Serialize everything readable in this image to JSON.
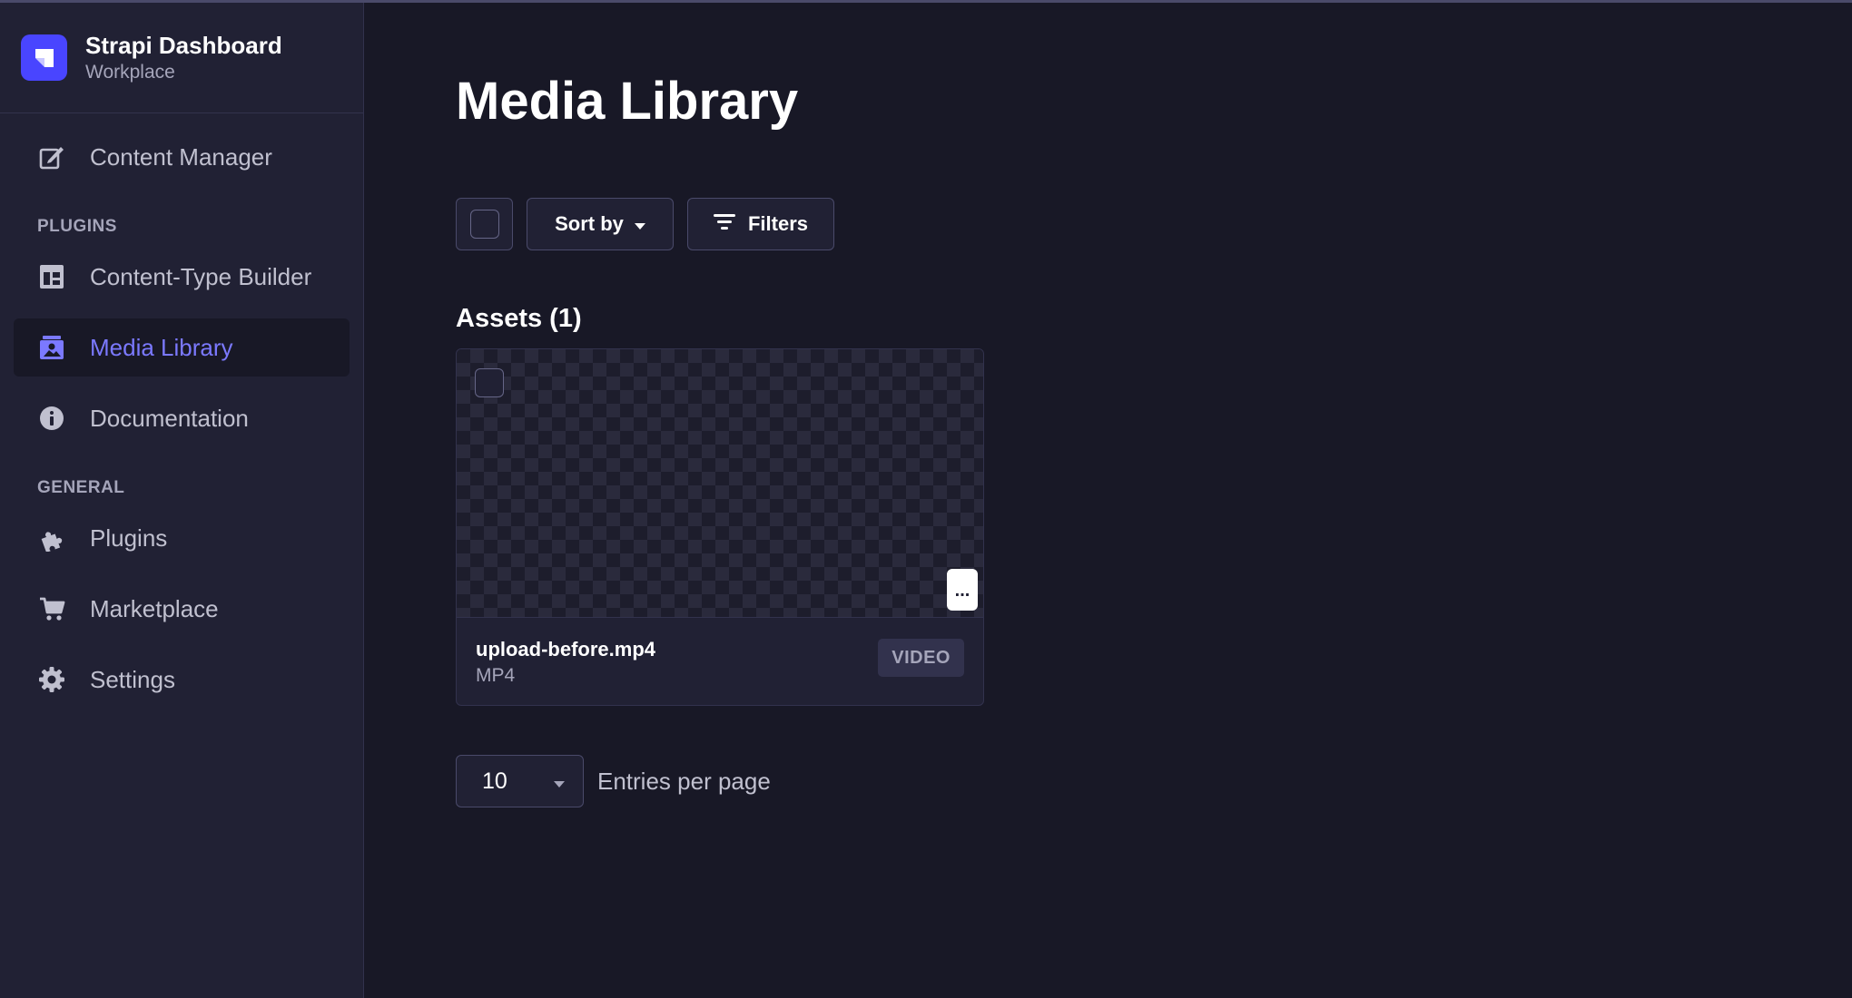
{
  "brand": {
    "title": "Strapi Dashboard",
    "subtitle": "Workplace"
  },
  "sidebar": {
    "content_manager": "Content Manager",
    "plugins_section": "PLUGINS",
    "plugins": [
      {
        "label": "Content-Type Builder",
        "icon": "layout-icon"
      },
      {
        "label": "Media Library",
        "icon": "image-icon",
        "active": true
      },
      {
        "label": "Documentation",
        "icon": "info-icon"
      }
    ],
    "general_section": "GENERAL",
    "general": [
      {
        "label": "Plugins",
        "icon": "puzzle-icon"
      },
      {
        "label": "Marketplace",
        "icon": "cart-icon"
      },
      {
        "label": "Settings",
        "icon": "gear-icon"
      }
    ]
  },
  "main": {
    "title": "Media Library",
    "toolbar": {
      "sort_label": "Sort by",
      "filters_label": "Filters"
    },
    "assets_title": "Assets (1)",
    "asset": {
      "name": "upload-before.mp4",
      "extension": "MP4",
      "badge": "VIDEO",
      "more_label": "..."
    },
    "pagination": {
      "page_size": "10",
      "label": "Entries per page"
    }
  },
  "colors": {
    "accent": "#7b79ff",
    "brand": "#4945ff",
    "background": "#181826",
    "sidebar": "#212134"
  }
}
